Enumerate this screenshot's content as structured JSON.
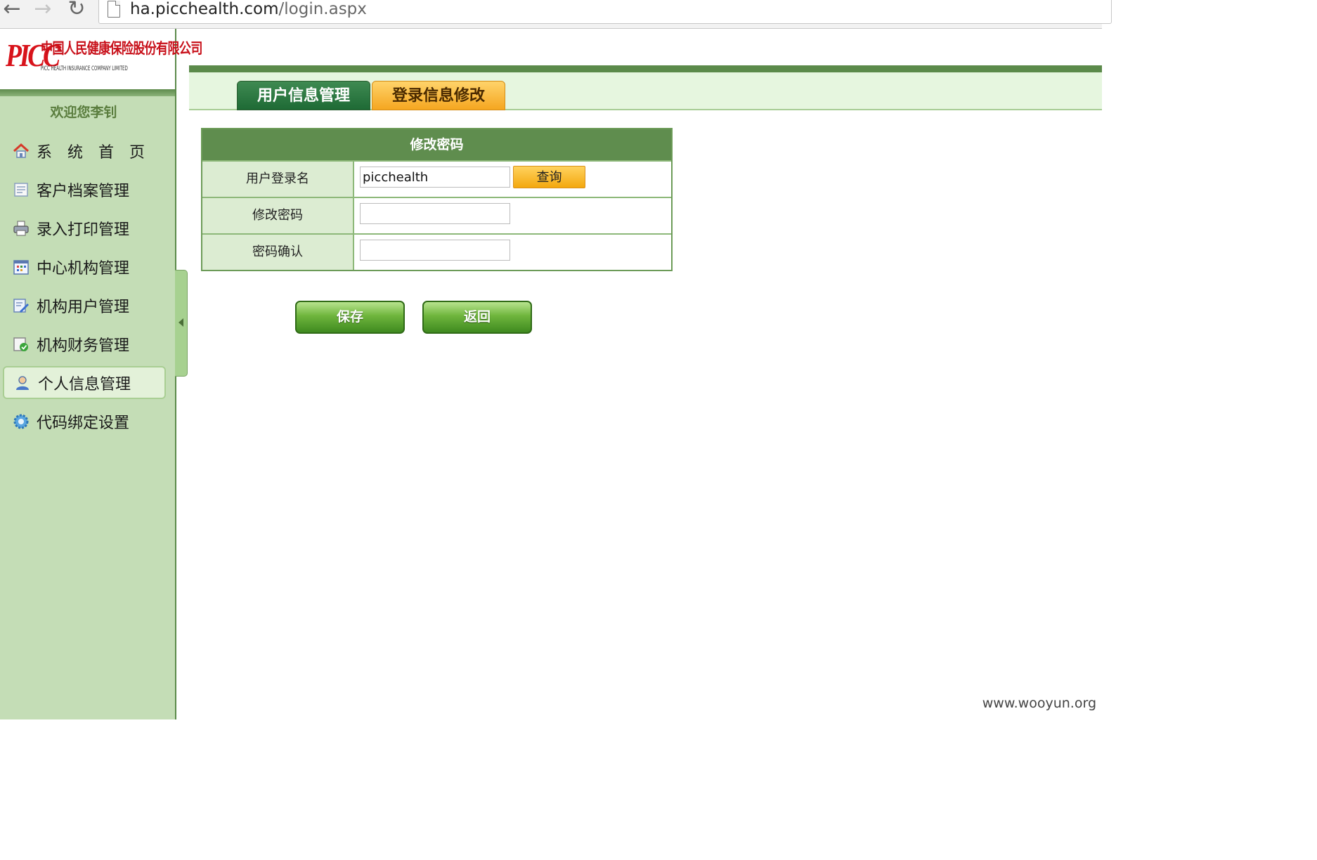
{
  "browser": {
    "url_host": "ha.picchealth.com",
    "url_path": "/login.aspx"
  },
  "sidebar": {
    "logo_mark": "PICC",
    "logo_cn": "中国人民健康保险股份有限公司",
    "logo_en": "PICC HEALTH INSURANCE COMPANY LIMITED",
    "welcome": "欢迎您李钊",
    "items": [
      {
        "label": "系　统　首　页",
        "icon": "home-icon",
        "active": false
      },
      {
        "label": "客户档案管理",
        "icon": "document-icon",
        "active": false
      },
      {
        "label": "录入打印管理",
        "icon": "printer-icon",
        "active": false
      },
      {
        "label": "中心机构管理",
        "icon": "calendar-grid-icon",
        "active": false
      },
      {
        "label": "机构用户管理",
        "icon": "edit-form-icon",
        "active": false
      },
      {
        "label": "机构财务管理",
        "icon": "finance-check-icon",
        "active": false
      },
      {
        "label": "个人信息管理",
        "icon": "user-icon",
        "active": true
      },
      {
        "label": "代码绑定设置",
        "icon": "gear-icon",
        "active": false
      }
    ]
  },
  "tabs": [
    {
      "label": "用户信息管理",
      "active": true
    },
    {
      "label": "登录信息修改",
      "active": false
    }
  ],
  "form": {
    "title": "修改密码",
    "rows": [
      {
        "label": "用户登录名",
        "value": "picchealth",
        "has_button": true
      },
      {
        "label": "修改密码",
        "value": ""
      },
      {
        "label": "密码确认",
        "value": ""
      }
    ],
    "query_label": "查询"
  },
  "actions": {
    "save_label": "保存",
    "back_label": "返回"
  },
  "watermark": "www.wooyun.org",
  "colors": {
    "sidebar_bg": "#c4ddb6",
    "accent_green": "#5b8a4a",
    "tab_active": "#2a7a40",
    "tab_inactive": "#f5a620",
    "brand_red": "#d8131b"
  }
}
